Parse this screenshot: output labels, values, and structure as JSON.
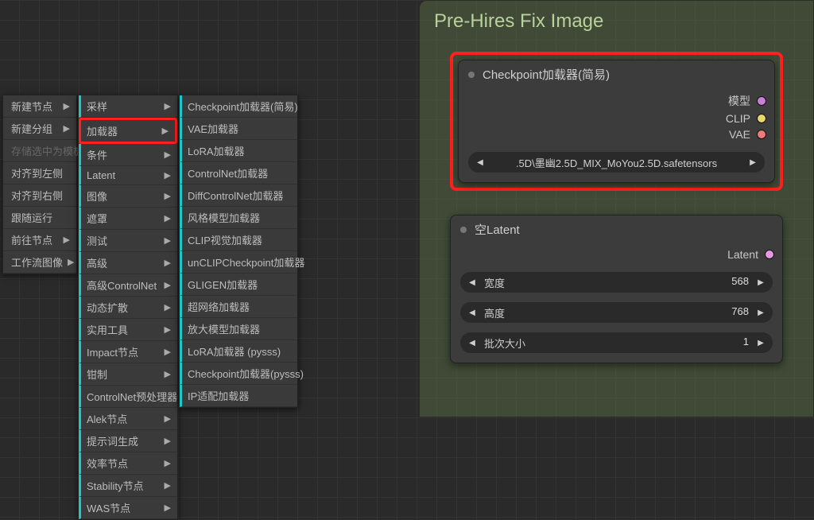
{
  "menu": {
    "col1": [
      {
        "label": "新建节点",
        "arrow": true,
        "disabled": false
      },
      {
        "label": "新建分组",
        "arrow": true,
        "disabled": false
      },
      {
        "label": "存储选中为模板",
        "arrow": false,
        "disabled": true
      },
      {
        "label": "对齐到左侧",
        "arrow": false,
        "disabled": false
      },
      {
        "label": "对齐到右侧",
        "arrow": false,
        "disabled": false
      },
      {
        "label": "跟随运行",
        "arrow": false,
        "disabled": false
      },
      {
        "label": "前往节点",
        "arrow": true,
        "disabled": false
      },
      {
        "label": "工作流图像",
        "arrow": true,
        "disabled": false
      }
    ],
    "col2": [
      {
        "label": "采样",
        "arrow": true
      },
      {
        "label": "加载器",
        "arrow": true,
        "highlight": true
      },
      {
        "label": "条件",
        "arrow": true
      },
      {
        "label": "Latent",
        "arrow": true
      },
      {
        "label": "图像",
        "arrow": true
      },
      {
        "label": "遮罩",
        "arrow": true
      },
      {
        "label": "测试",
        "arrow": true
      },
      {
        "label": "高级",
        "arrow": true
      },
      {
        "label": "高级ControlNet",
        "arrow": true
      },
      {
        "label": "动态扩散",
        "arrow": true
      },
      {
        "label": "实用工具",
        "arrow": true
      },
      {
        "label": "Impact节点",
        "arrow": true
      },
      {
        "label": "钳制",
        "arrow": true
      },
      {
        "label": "ControlNet预处理器",
        "arrow": true
      },
      {
        "label": "Alek节点",
        "arrow": true
      },
      {
        "label": "提示词生成",
        "arrow": true
      },
      {
        "label": "效率节点",
        "arrow": true
      },
      {
        "label": "Stability节点",
        "arrow": true
      },
      {
        "label": "WAS节点",
        "arrow": true
      }
    ],
    "col3": [
      {
        "label": "Checkpoint加载器(简易)"
      },
      {
        "label": "VAE加载器"
      },
      {
        "label": "LoRA加载器"
      },
      {
        "label": "ControlNet加载器"
      },
      {
        "label": "DiffControlNet加载器"
      },
      {
        "label": "风格模型加载器"
      },
      {
        "label": "CLIP视觉加载器"
      },
      {
        "label": "unCLIPCheckpoint加载器"
      },
      {
        "label": "GLIGEN加载器"
      },
      {
        "label": "超网络加载器"
      },
      {
        "label": "放大模型加载器"
      },
      {
        "label": "LoRA加载器 (pysss)"
      },
      {
        "label": "Checkpoint加载器(pysss)"
      },
      {
        "label": "IP适配加载器"
      }
    ]
  },
  "group": {
    "title": "Pre-Hires Fix Image",
    "checkpoint": {
      "title": "Checkpoint加载器(简易)",
      "outputs": [
        {
          "label": "模型",
          "port": "model"
        },
        {
          "label": "CLIP",
          "port": "clip"
        },
        {
          "label": "VAE",
          "port": "vae"
        }
      ],
      "value": ".5D\\墨幽2.5D_MIX_MoYou2.5D.safetensors"
    },
    "latent": {
      "title": "空Latent",
      "outputs": [
        {
          "label": "Latent",
          "port": "latent"
        }
      ],
      "widgets": [
        {
          "label": "宽度",
          "value": "568"
        },
        {
          "label": "高度",
          "value": "768"
        },
        {
          "label": "批次大小",
          "value": "1"
        }
      ]
    }
  },
  "glyph": {
    "left": "◀",
    "right": "▶",
    "sub": "▶"
  }
}
